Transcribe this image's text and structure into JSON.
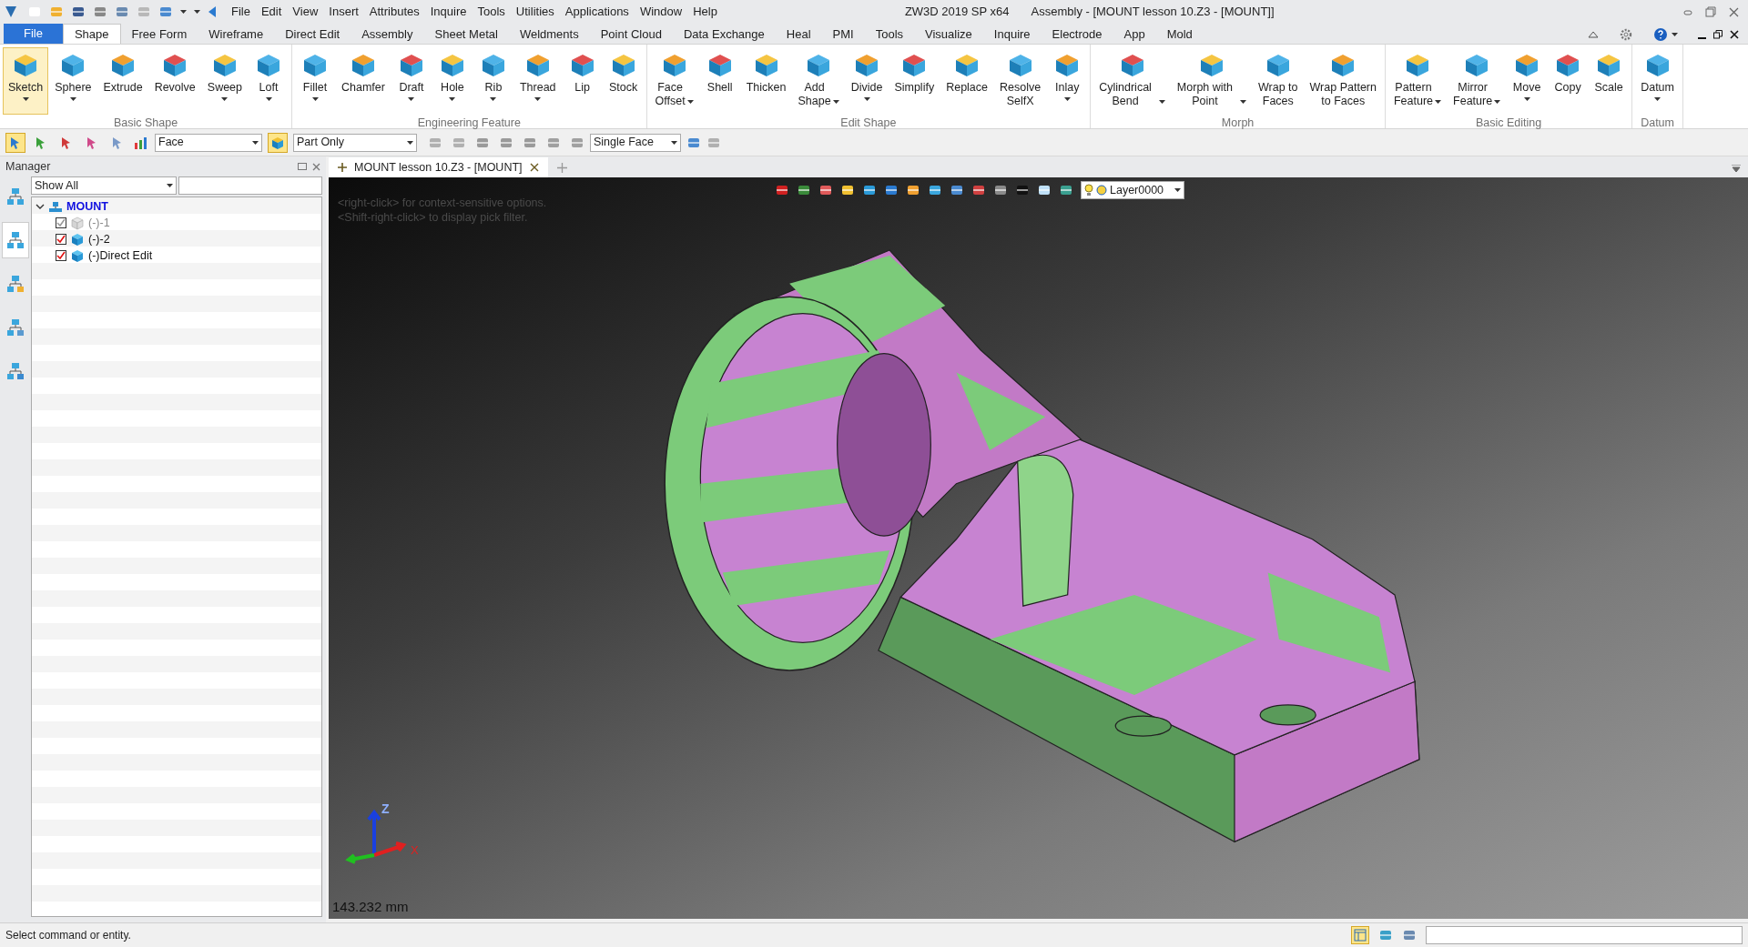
{
  "title_bar": {
    "menu": [
      "File",
      "Edit",
      "View",
      "Insert",
      "Attributes",
      "Inquire",
      "Tools",
      "Utilities",
      "Applications",
      "Window",
      "Help"
    ],
    "app": "ZW3D 2019 SP x64",
    "document": "Assembly - [MOUNT lesson 10.Z3 - [MOUNT]]"
  },
  "ribbon_tabs": [
    {
      "label": "File",
      "kind": "file",
      "selected": false
    },
    {
      "label": "Shape",
      "kind": "tab",
      "selected": true
    },
    {
      "label": "Free Form",
      "kind": "tab",
      "selected": false
    },
    {
      "label": "Wireframe",
      "kind": "tab",
      "selected": false
    },
    {
      "label": "Direct Edit",
      "kind": "tab",
      "selected": false
    },
    {
      "label": "Assembly",
      "kind": "tab",
      "selected": false
    },
    {
      "label": "Sheet Metal",
      "kind": "tab",
      "selected": false
    },
    {
      "label": "Weldments",
      "kind": "tab",
      "selected": false
    },
    {
      "label": "Point Cloud",
      "kind": "tab",
      "selected": false
    },
    {
      "label": "Data Exchange",
      "kind": "tab",
      "selected": false
    },
    {
      "label": "Heal",
      "kind": "tab",
      "selected": false
    },
    {
      "label": "PMI",
      "kind": "tab",
      "selected": false
    },
    {
      "label": "Tools",
      "kind": "tab",
      "selected": false
    },
    {
      "label": "Visualize",
      "kind": "tab",
      "selected": false
    },
    {
      "label": "Inquire",
      "kind": "tab",
      "selected": false
    },
    {
      "label": "Electrode",
      "kind": "tab",
      "selected": false
    },
    {
      "label": "App",
      "kind": "tab",
      "selected": false
    },
    {
      "label": "Mold",
      "kind": "tab",
      "selected": false
    }
  ],
  "ribbon_groups": [
    {
      "label": "Basic Shape",
      "buttons": [
        {
          "label": "Sketch",
          "kind": "below",
          "selected": true
        },
        {
          "label": "Sphere",
          "kind": "below",
          "selected": false
        },
        {
          "label": "Extrude",
          "kind": "plain",
          "selected": false
        },
        {
          "label": "Revolve",
          "kind": "plain",
          "selected": false
        },
        {
          "label": "Sweep",
          "kind": "below",
          "selected": false
        },
        {
          "label": "Loft",
          "kind": "below",
          "selected": false
        }
      ]
    },
    {
      "label": "Engineering Feature",
      "buttons": [
        {
          "label": "Fillet",
          "kind": "below",
          "selected": false
        },
        {
          "label": "Chamfer",
          "kind": "plain",
          "selected": false
        },
        {
          "label": "Draft",
          "kind": "below",
          "selected": false
        },
        {
          "label": "Hole",
          "kind": "below",
          "selected": false
        },
        {
          "label": "Rib",
          "kind": "below",
          "selected": false
        },
        {
          "label": "Thread",
          "kind": "below",
          "selected": false
        },
        {
          "label": "Lip",
          "kind": "plain",
          "selected": false
        },
        {
          "label": "Stock",
          "kind": "plain",
          "selected": false
        }
      ]
    },
    {
      "label": "Edit Shape",
      "buttons": [
        {
          "label": "Face\nOffset",
          "kind": "inline",
          "selected": false
        },
        {
          "label": "Shell",
          "kind": "plain",
          "selected": false
        },
        {
          "label": "Thicken",
          "kind": "plain",
          "selected": false
        },
        {
          "label": "Add\nShape",
          "kind": "inline",
          "selected": false
        },
        {
          "label": "Divide",
          "kind": "below",
          "selected": false
        },
        {
          "label": "Simplify",
          "kind": "plain",
          "selected": false
        },
        {
          "label": "Replace",
          "kind": "plain",
          "selected": false
        },
        {
          "label": "Resolve\nSelfX",
          "kind": "plain",
          "selected": false
        },
        {
          "label": "Inlay",
          "kind": "below",
          "selected": false
        }
      ]
    },
    {
      "label": "Morph",
      "buttons": [
        {
          "label": "Cylindrical\nBend",
          "kind": "side",
          "selected": false
        },
        {
          "label": "Morph with\nPoint",
          "kind": "side",
          "selected": false
        },
        {
          "label": "Wrap to\nFaces",
          "kind": "plain",
          "selected": false
        },
        {
          "label": "Wrap Pattern\nto Faces",
          "kind": "plain",
          "selected": false
        }
      ]
    },
    {
      "label": "Basic Editing",
      "buttons": [
        {
          "label": "Pattern\nFeature",
          "kind": "inline",
          "selected": false
        },
        {
          "label": "Mirror\nFeature",
          "kind": "inline",
          "selected": false
        },
        {
          "label": "Move",
          "kind": "below",
          "selected": false
        },
        {
          "label": "Copy",
          "kind": "plain",
          "selected": false
        },
        {
          "label": "Scale",
          "kind": "plain",
          "selected": false
        }
      ]
    },
    {
      "label": "Datum",
      "buttons": [
        {
          "label": "Datum",
          "kind": "below",
          "selected": false
        }
      ]
    }
  ],
  "toolbar": {
    "pick_tools": [
      {
        "selected": true
      },
      {
        "selected": false
      },
      {
        "selected": false
      },
      {
        "selected": false
      },
      {
        "selected": false
      }
    ],
    "filter": "Face",
    "scope": "Part Only",
    "scope_selected": true,
    "pick_mode": "Single Face"
  },
  "manager": {
    "title": "Manager",
    "tabs": [
      {
        "selected": false
      },
      {
        "selected": true
      },
      {
        "selected": false
      },
      {
        "selected": false
      },
      {
        "selected": false
      }
    ],
    "filter": "Show All",
    "tree": [
      {
        "label": "MOUNT",
        "expanded": true,
        "children": [
          {
            "label": "(-)-1",
            "checked": true,
            "visible": false
          },
          {
            "label": "(-)-2",
            "checked": true,
            "visible": true
          },
          {
            "label": "(-)Direct Edit",
            "checked": true,
            "visible": true
          }
        ]
      }
    ]
  },
  "document_tab": {
    "label": "MOUNT lesson 10.Z3 - [MOUNT]",
    "selected": true
  },
  "viewport": {
    "hints": [
      "<right-click> for context-sensitive options.",
      "<Shift-right-click> to display pick filter."
    ],
    "layer": "Layer0000",
    "axes": [
      "Z",
      "X"
    ],
    "measurement": "143.232 mm"
  },
  "status_bar": {
    "message": "Select command or entity."
  }
}
